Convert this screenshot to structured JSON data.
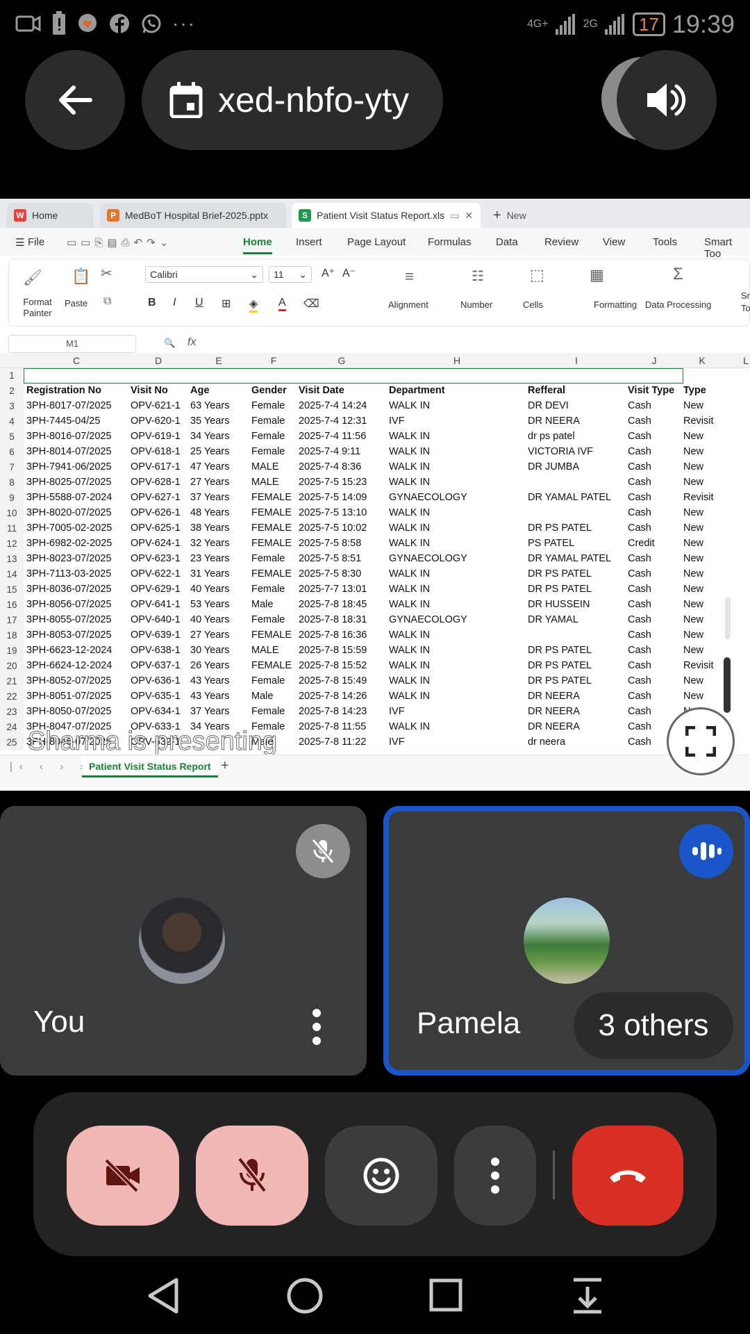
{
  "status_bar": {
    "time": "19:39",
    "battery": "17",
    "net_1": "4G+",
    "net_2": "2G",
    "icons": [
      "camera-icon",
      "battery-alert-icon",
      "heart-chat-icon",
      "facebook-icon",
      "whatsapp-icon",
      "more-dots-icon"
    ]
  },
  "meeting": {
    "code": "xed-nbfo-yty",
    "presenting_text": "Sharma is presenting"
  },
  "spreadsheet": {
    "tabs": [
      {
        "label": "Home",
        "icon": "W",
        "color": "#e8423b"
      },
      {
        "label": "MedBoT Hospital Brief-2025.pptx",
        "icon": "P",
        "color": "#e8742b"
      },
      {
        "label": "Patient Visit Status Report.xls",
        "icon": "S",
        "color": "#1e9a4f"
      },
      {
        "label": "New",
        "icon": "+",
        "color": "#666666"
      }
    ],
    "menu": [
      "File",
      "Home",
      "Insert",
      "Page Layout",
      "Formulas",
      "Data",
      "Review",
      "View",
      "Tools",
      "Smart Too"
    ],
    "active_menu": "Home",
    "ribbon": {
      "format_painter": "Format Painter",
      "paste": "Paste",
      "font_name": "Calibri",
      "font_size": "11",
      "alignment": "Alignment",
      "number": "Number",
      "cells": "Cells",
      "formatting": "Formatting",
      "data_processing": "Data Processing",
      "sm": "Sm To"
    },
    "cell_ref": "M1",
    "fx": "fx",
    "column_letters": [
      "C",
      "D",
      "E",
      "F",
      "G",
      "H",
      "I",
      "J",
      "K",
      "L"
    ],
    "headers": [
      "Registration No",
      "Visit No",
      "Age",
      "Gender",
      "Visit Date",
      "Department",
      "Refferal",
      "Visit Type",
      "Type"
    ],
    "rows": [
      [
        "3PH-8017-07/2025",
        "OPV-621-1",
        "63 Years",
        "Female",
        "2025-7-4 14:24",
        "WALK IN",
        "DR DEVI",
        "Cash",
        "New"
      ],
      [
        "3PH-7445-04/25",
        "OPV-620-1",
        "35 Years",
        "Female",
        "2025-7-4 12:31",
        "IVF",
        "DR NEERA",
        "Cash",
        "Revisit"
      ],
      [
        "3PH-8016-07/2025",
        "OPV-619-1",
        "34 Years",
        "Female",
        "2025-7-4 11:56",
        "WALK IN",
        "dr ps patel",
        "Cash",
        "New"
      ],
      [
        "3PH-8014-07/2025",
        "OPV-618-1",
        "25 Years",
        "Female",
        "2025-7-4 9:11",
        "WALK IN",
        "VICTORIA IVF",
        "Cash",
        "New"
      ],
      [
        "3PH-7941-06/2025",
        "OPV-617-1",
        "47 Years",
        "MALE",
        "2025-7-4 8:36",
        "WALK IN",
        "DR JUMBA",
        "Cash",
        "New"
      ],
      [
        "3PH-8025-07/2025",
        "OPV-628-1",
        "27 Years",
        "MALE",
        "2025-7-5 15:23",
        "WALK IN",
        "",
        "Cash",
        "New"
      ],
      [
        "3PH-5588-07-2024",
        "OPV-627-1",
        "37 Years",
        "FEMALE",
        "2025-7-5 14:09",
        "GYNAECOLOGY",
        "DR YAMAL PATEL",
        "Cash",
        "Revisit"
      ],
      [
        "3PH-8020-07/2025",
        "OPV-626-1",
        "48 Years",
        "FEMALE",
        "2025-7-5 13:10",
        "WALK IN",
        "",
        "Cash",
        "New"
      ],
      [
        "3PH-7005-02-2025",
        "OPV-625-1",
        "38 Years",
        "FEMALE",
        "2025-7-5 10:02",
        "WALK IN",
        "DR PS PATEL",
        "Cash",
        "New"
      ],
      [
        "3PH-6982-02-2025",
        "OPV-624-1",
        "32 Years",
        "FEMALE",
        "2025-7-5 8:58",
        "WALK IN",
        "PS PATEL",
        "Credit",
        "New"
      ],
      [
        "3PH-8023-07/2025",
        "OPV-623-1",
        "23 Years",
        "Female",
        "2025-7-5 8:51",
        "GYNAECOLOGY",
        "DR YAMAL PATEL",
        "Cash",
        "New"
      ],
      [
        "3PH-7113-03-2025",
        "OPV-622-1",
        "31 Years",
        "FEMALE",
        "2025-7-5 8:30",
        "WALK IN",
        "DR PS PATEL",
        "Cash",
        "New"
      ],
      [
        "3PH-8036-07/2025",
        "OPV-629-1",
        "40 Years",
        "Female",
        "2025-7-7 13:01",
        "WALK IN",
        "DR PS PATEL",
        "Cash",
        "New"
      ],
      [
        "3PH-8056-07/2025",
        "OPV-641-1",
        "53 Years",
        "Male",
        "2025-7-8 18:45",
        "WALK IN",
        "DR HUSSEIN",
        "Cash",
        "New"
      ],
      [
        "3PH-8055-07/2025",
        "OPV-640-1",
        "40 Years",
        "Female",
        "2025-7-8 18:31",
        "GYNAECOLOGY",
        "DR YAMAL",
        "Cash",
        "New"
      ],
      [
        "3PH-8053-07/2025",
        "OPV-639-1",
        "27 Years",
        "FEMALE",
        "2025-7-8 16:36",
        "WALK IN",
        "",
        "Cash",
        "New"
      ],
      [
        "3PH-6623-12-2024",
        "OPV-638-1",
        "30 Years",
        "MALE",
        "2025-7-8 15:59",
        "WALK IN",
        "DR PS PATEL",
        "Cash",
        "New"
      ],
      [
        "3PH-6624-12-2024",
        "OPV-637-1",
        "26 Years",
        "FEMALE",
        "2025-7-8 15:52",
        "WALK IN",
        "DR PS PATEL",
        "Cash",
        "Revisit"
      ],
      [
        "3PH-8052-07/2025",
        "OPV-636-1",
        "43 Years",
        "Female",
        "2025-7-8 15:49",
        "WALK IN",
        "DR PS PATEL",
        "Cash",
        "New"
      ],
      [
        "3PH-8051-07/2025",
        "OPV-635-1",
        "43 Years",
        "Male",
        "2025-7-8 14:26",
        "WALK IN",
        "DR NEERA",
        "Cash",
        "New"
      ],
      [
        "3PH-8050-07/2025",
        "OPV-634-1",
        "37 Years",
        "Female",
        "2025-7-8 14:23",
        "IVF",
        "DR NEERA",
        "Cash",
        "New"
      ],
      [
        "3PH-8047-07/2025",
        "OPV-633-1",
        "34 Years",
        "Female",
        "2025-7-8 11:55",
        "WALK IN",
        "DR NEERA",
        "Cash",
        ""
      ],
      [
        "3PH-8046-07/2025",
        "OPV-632-1",
        "",
        "Male",
        "2025-7-8 11:22",
        "IVF",
        "dr neera",
        "Cash",
        ""
      ]
    ],
    "sheet_tab": "Patient Visit Status Report"
  },
  "participants": {
    "you": "You",
    "other": "Pamela",
    "others_count": "3 others"
  },
  "colors": {
    "active_border": "#1a56c9",
    "leave_red": "#d93025",
    "muted_pink": "#f2b8b5",
    "sheet_green": "#1a7f37"
  }
}
